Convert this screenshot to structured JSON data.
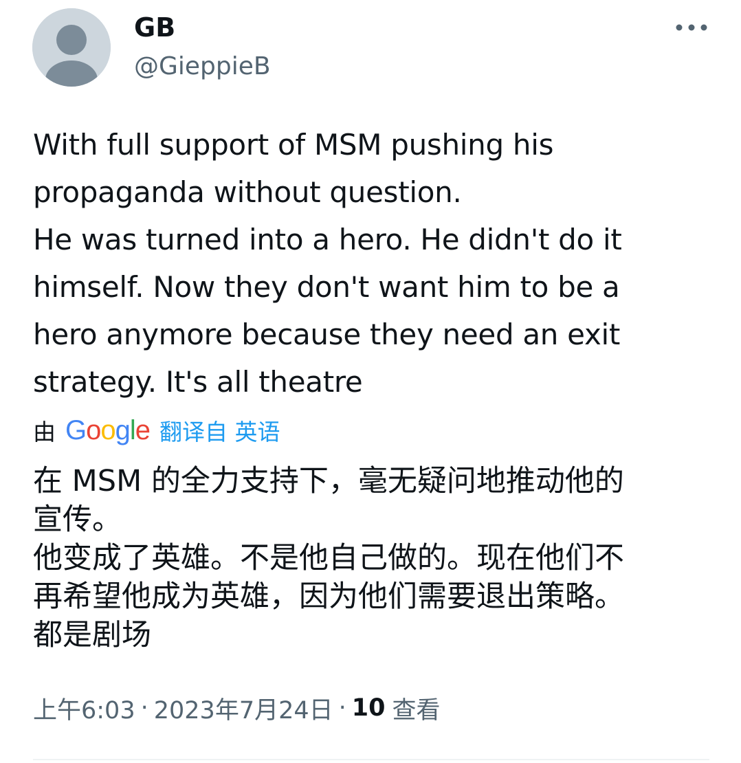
{
  "author": {
    "display_name": "GB",
    "handle": "@GieppieB"
  },
  "tweet": {
    "text": "With full support of MSM pushing his\npropaganda without question.\nHe was turned into a hero. He didn't do it\nhimself. Now they don't want him to be a\nhero anymore because they need an exit\nstrategy. It's all theatre",
    "translation": {
      "by_label": "由",
      "provider": "Google",
      "provider_letters": [
        "G",
        "o",
        "o",
        "g",
        "l",
        "e"
      ],
      "from_label": "翻译自 英语",
      "text": "在 MSM 的全力支持下，毫无疑问地推动他的\n宣传。\n他变成了英雄。不是他自己做的。现在他们不\n再希望他成为英雄，因为他们需要退出策略。\n都是剧场"
    },
    "time": "上午6:03",
    "date": "2023年7月24日",
    "separator": "·",
    "views_count": "10",
    "views_label": "查看"
  },
  "icons": {
    "avatar": "default-avatar-icon",
    "more": "more-horizontal-icon"
  },
  "colors": {
    "text_primary": "#0f1419",
    "text_secondary": "#536471",
    "link_blue": "#1d9bf0",
    "avatar_bg": "#cdd6dd",
    "avatar_figure": "#7c8c99",
    "google_blue": "#4285f4",
    "google_red": "#ea4335",
    "google_yellow": "#fbbc05",
    "google_green": "#34a853"
  }
}
